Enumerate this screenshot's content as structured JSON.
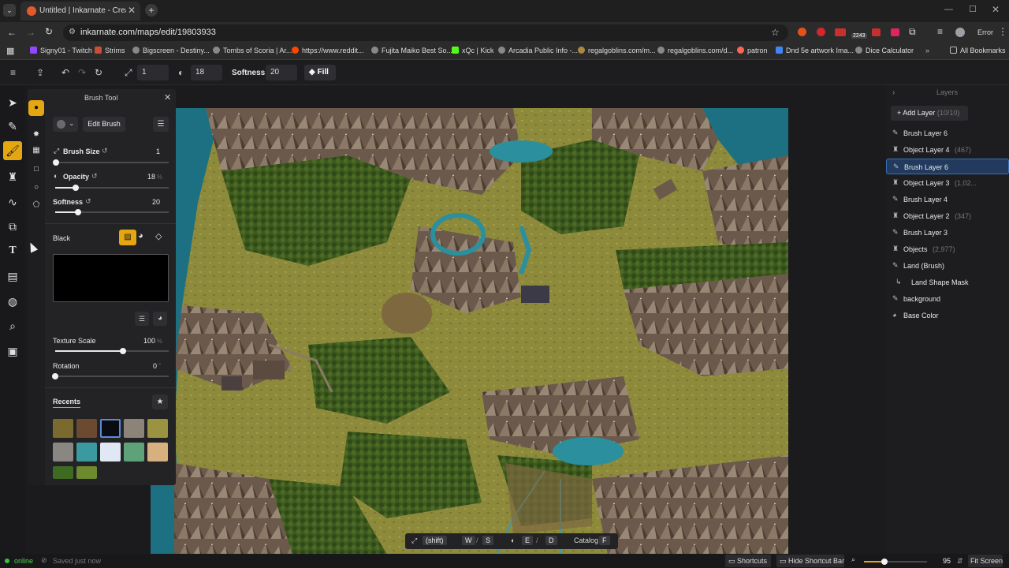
{
  "browser": {
    "tab_title": "Untitled | Inkarnate - Create Fa",
    "url": "inkarnate.com/maps/edit/19803933",
    "profile_label": "Error",
    "ext_badge": "2243",
    "bookmarks": [
      "Signy01 - Twitch",
      "Strims",
      "Bigscreen - Destiny...",
      "Tombs of Scoria | Ar...",
      "https://www.reddit...",
      "Fujita Maiko Best So...",
      "xQc | Kick",
      "Arcadia Public Info -...",
      "regalgoblins.com/m...",
      "regalgoblins.com/d...",
      "patron",
      "Dnd 5e artwork Ima...",
      "Dice Calculator"
    ],
    "all_bookmarks": "All Bookmarks"
  },
  "toolbar": {
    "size_value": "1",
    "opacity_value": "18",
    "softness_label": "Softness:",
    "softness_value": "20",
    "fill_label": "Fill"
  },
  "brush_panel": {
    "title": "Brush Tool",
    "edit_brush": "Edit Brush",
    "brush_size_label": "Brush Size",
    "brush_size_value": "1",
    "brush_size_level": 0.01,
    "opacity_label": "Opacity",
    "opacity_value": "18",
    "opacity_unit": "%",
    "opacity_level": 0.18,
    "softness_label": "Softness",
    "softness_value": "20",
    "softness_level": 0.2,
    "color_name": "Black",
    "color_hex": "#000000",
    "texture_scale_label": "Texture Scale",
    "texture_scale_value": "100",
    "texture_scale_unit": "%",
    "texture_scale_level": 0.6,
    "rotation_label": "Rotation",
    "rotation_value": "0",
    "rotation_unit": "°",
    "rotation_level": 0,
    "recents_label": "Recents",
    "recent_swatches": [
      "#7a6a2e",
      "#6b4a30",
      "#0b0b12",
      "#8c8478",
      "#9a9440",
      "#8a8682",
      "#3b9aa0",
      "#dfe8f4",
      "#5ea27a",
      "#d6b07e",
      "#3f6a22",
      "#6e8a2e"
    ]
  },
  "layers": {
    "title": "Layers",
    "add_layer": "Add Layer",
    "add_layer_count": "(10/10)",
    "items": [
      {
        "name": "Brush Layer 6",
        "count": "",
        "icon": "brush-icon"
      },
      {
        "name": "Object Layer 4",
        "count": "(467)",
        "icon": "object-icon"
      },
      {
        "name": "Brush Layer 6",
        "count": "",
        "icon": "brush-icon"
      },
      {
        "name": "Object Layer 3",
        "count": "(1,02...",
        "icon": "object-icon"
      },
      {
        "name": "Brush Layer 4",
        "count": "",
        "icon": "brush-icon"
      },
      {
        "name": "Object Layer 2",
        "count": "(347)",
        "icon": "object-icon"
      },
      {
        "name": "Brush Layer 3",
        "count": "",
        "icon": "brush-icon"
      },
      {
        "name": "Objects",
        "count": "(2,977)",
        "icon": "object-icon"
      },
      {
        "name": "Land (Brush)",
        "count": "",
        "icon": "brush-icon"
      },
      {
        "name": "Land Shape Mask",
        "count": "",
        "icon": "mask-icon"
      },
      {
        "name": "background",
        "count": "",
        "icon": "brush-icon"
      },
      {
        "name": "Base Color",
        "count": "",
        "icon": "palette-icon"
      }
    ]
  },
  "status": {
    "online": "online",
    "saved": "Saved just now",
    "shortcuts": "Shortcuts",
    "hide_shortcut_bar": "Hide Shortcut Bar",
    "zoom": "95",
    "fit_screen": "Fit Screen"
  },
  "shortcut_bar": {
    "shift": "(shift)",
    "w": "W",
    "s": "S",
    "e": "E",
    "d": "D",
    "catalog": "Catalog",
    "f": "F"
  }
}
